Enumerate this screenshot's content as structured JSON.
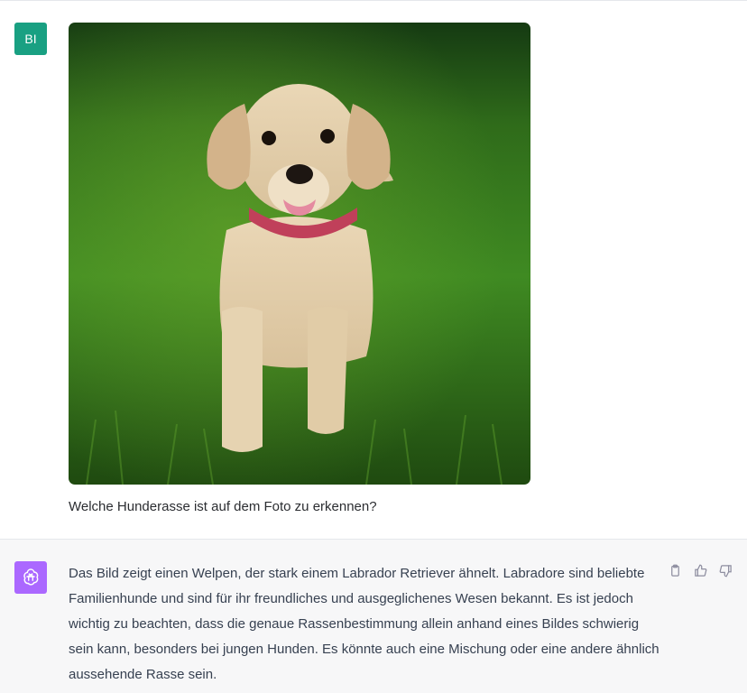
{
  "user": {
    "avatar_initials": "BI",
    "avatar_color": "#19a082",
    "question": "Welche Hunderasse ist auf dem Foto zu erkennen?"
  },
  "assistant": {
    "avatar_color": "#ab68ff",
    "answer": "Das Bild zeigt einen Welpen, der stark einem Labrador Retriever ähnelt. Labradore sind beliebte Familienhunde und sind für ihr freundliches und ausgeglichenes Wesen bekannt. Es ist jedoch wichtig zu beachten, dass die genaue Rassenbestimmung allein anhand eines Bildes schwierig sein kann, besonders bei jungen Hunden. Es könnte auch eine Mischung oder eine andere ähnlich aussehende Rasse sein.",
    "actions": [
      "clipboard-icon",
      "thumbs-up-icon",
      "thumbs-down-icon"
    ]
  },
  "colors": {
    "user_bg": "#ffffff",
    "assistant_bg": "#f7f7f8"
  }
}
